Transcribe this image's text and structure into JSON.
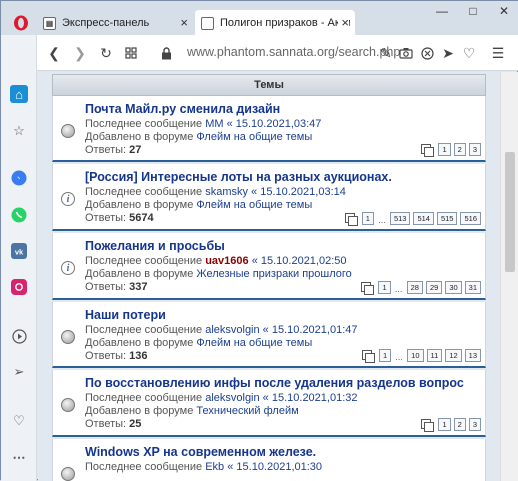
{
  "tabs": [
    {
      "title": "Экспресс-панель",
      "close": "×"
    },
    {
      "title": "Полигон призраков - Активн",
      "close": "×"
    }
  ],
  "window_controls": {
    "minimize": "—",
    "maximize": "□",
    "close": "✕"
  },
  "address_bar": {
    "url": "www.phantom.sannata.org/search.php"
  },
  "forum": {
    "header": "Темы",
    "topics": [
      {
        "title": "Почта Майл.ру сменила дизайн",
        "last_prefix": "Последнее сообщение ",
        "last_user": "MM",
        "last_user_red": false,
        "last_sep": " « ",
        "last_date": "15.10.2021,03:47",
        "forum_prefix": "Добавлено в форуме ",
        "forum_name": "Флейм на общие темы",
        "replies_label": "Ответы: ",
        "replies": "27",
        "status": "normal",
        "pages": [
          "1",
          "2",
          "3"
        ]
      },
      {
        "title": "[Россия] Интересные лоты на разных аукционах.",
        "last_prefix": "Последнее сообщение ",
        "last_user": "skamsky",
        "last_user_red": false,
        "last_sep": " « ",
        "last_date": "15.10.2021,03:14",
        "forum_prefix": "Добавлено в форуме ",
        "forum_name": "Флейм на общие темы",
        "replies_label": "Ответы: ",
        "replies": "5674",
        "status": "info",
        "pages": [
          "1",
          "…",
          "513",
          "514",
          "515",
          "516"
        ]
      },
      {
        "title": "Пожелания и просьбы",
        "last_prefix": "Последнее сообщение ",
        "last_user": "uav1606",
        "last_user_red": true,
        "last_sep": " « ",
        "last_date": "15.10.2021,02:50",
        "forum_prefix": "Добавлено в форуме ",
        "forum_name": "Железные призраки прошлого",
        "replies_label": "Ответы: ",
        "replies": "337",
        "status": "info",
        "pages": [
          "1",
          "…",
          "28",
          "29",
          "30",
          "31"
        ]
      },
      {
        "title": "Наши потери",
        "last_prefix": "Последнее сообщение ",
        "last_user": "aleksvolgin",
        "last_user_red": false,
        "last_sep": " « ",
        "last_date": "15.10.2021,01:47",
        "forum_prefix": "Добавлено в форуме ",
        "forum_name": "Флейм на общие темы",
        "replies_label": "Ответы: ",
        "replies": "136",
        "status": "normal",
        "pages": [
          "1",
          "…",
          "10",
          "11",
          "12",
          "13"
        ]
      },
      {
        "title": "По восстановлению инфы после удаления разделов вопрос",
        "last_prefix": "Последнее сообщение ",
        "last_user": "aleksvolgin",
        "last_user_red": false,
        "last_sep": " « ",
        "last_date": "15.10.2021,01:32",
        "forum_prefix": "Добавлено в форуме ",
        "forum_name": "Технический флейм",
        "replies_label": "Ответы: ",
        "replies": "25",
        "status": "normal",
        "pages": [
          "1",
          "2",
          "3"
        ]
      },
      {
        "title": "Windows XP на современном железе.",
        "last_prefix": "Последнее сообщение ",
        "last_user": "Ekb",
        "last_user_red": false,
        "last_sep": " « ",
        "last_date": "15.10.2021,01:30",
        "forum_prefix": "",
        "forum_name": "",
        "replies_label": "",
        "replies": "",
        "status": "normal",
        "pages": []
      }
    ]
  }
}
